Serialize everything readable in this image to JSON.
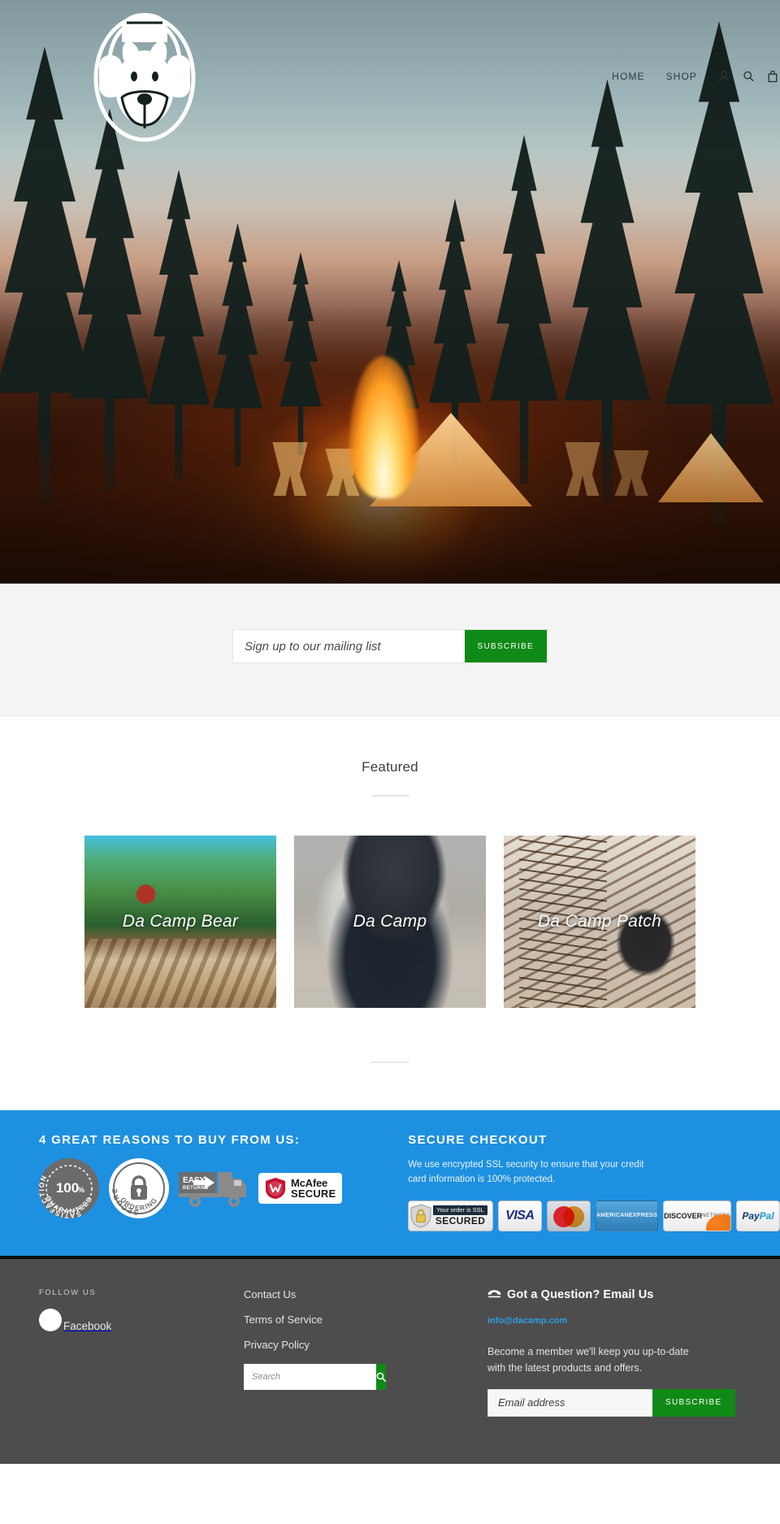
{
  "header": {
    "logo_alt": "Da Camp bear with headphones logo",
    "nav": [
      {
        "label": "HOME"
      },
      {
        "label": "SHOP"
      }
    ],
    "icons": [
      {
        "name": "user-account-icon"
      },
      {
        "name": "search-icon"
      },
      {
        "name": "cart-icon"
      }
    ]
  },
  "newsletter": {
    "placeholder": "Sign up to our mailing list",
    "value": "",
    "button_label": "SUBSCRIBE"
  },
  "featured": {
    "title": "Featured",
    "cards": [
      {
        "label": "Da Camp Bear"
      },
      {
        "label": "Da Camp"
      },
      {
        "label": "Da Camp Patch"
      }
    ]
  },
  "trust": {
    "heading": "4 GREAT REASONS TO BUY FROM US:",
    "badges": [
      {
        "name": "satisfaction-guaranteed-seal",
        "top_text": "SATISFACTION",
        "center_text": "100",
        "center_suffix": "%",
        "bottom_text": "GUARANTEED"
      },
      {
        "name": "secure-ordering-seal",
        "top_text": "SECURE",
        "bottom_text": "ORDERING"
      },
      {
        "name": "easy-returns-truck",
        "line1": "EASY",
        "line2": "RETURNS"
      },
      {
        "name": "mcafee-secure-badge",
        "line1": "McAfee",
        "line2": "SECURE"
      }
    ],
    "checkout": {
      "heading": "SECURE CHECKOUT",
      "text": "We use encrypted SSL security to ensure that your credit card information is 100% protected.",
      "payment_badges": [
        {
          "name": "ssl-secured-badge",
          "top": "Your order is SSL",
          "bottom": "SECURED"
        },
        {
          "name": "visa-logo",
          "label": "VISA"
        },
        {
          "name": "mastercard-logo",
          "label": "MasterCard"
        },
        {
          "name": "amex-logo",
          "line1": "AMERICAN",
          "line2": "EXPRESS"
        },
        {
          "name": "discover-logo",
          "line1": "DISCOVER",
          "line2": "NETWORK"
        },
        {
          "name": "paypal-logo",
          "label1": "Pay",
          "label2": "Pal"
        }
      ]
    },
    "accent_color": "#1e90e0"
  },
  "footer": {
    "follow_heading": "FOLLOW US",
    "social": [
      {
        "name": "facebook-icon",
        "label": "Facebook"
      }
    ],
    "links": [
      {
        "label": "Contact Us"
      },
      {
        "label": "Terms of Service"
      },
      {
        "label": "Privacy Policy"
      }
    ],
    "search": {
      "placeholder": "Search",
      "value": ""
    },
    "contact": {
      "heading": "Got a Question? Email Us",
      "email": "info@dacamp.com",
      "blurb": "Become a member we'll keep you up-to-date with the latest products and offers.",
      "input_placeholder": "Email address",
      "input_value": "",
      "button_label": "SUBSCRIBE"
    },
    "accent_color": "#108a16",
    "background_color": "#4d4d4d"
  }
}
